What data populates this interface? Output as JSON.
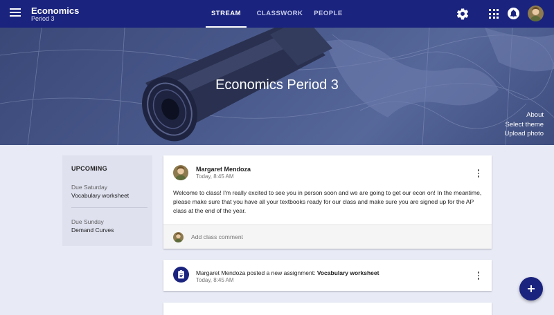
{
  "header": {
    "class_name": "Economics",
    "section": "Period 3",
    "tabs": [
      {
        "label": "STREAM",
        "active": true
      },
      {
        "label": "CLASSWORK",
        "active": false
      },
      {
        "label": "PEOPLE",
        "active": false
      }
    ],
    "icons": [
      "menu-icon",
      "gear-icon",
      "apps-grid-icon",
      "notification-icon",
      "avatar"
    ],
    "color": "#1a237e"
  },
  "banner": {
    "title": "Economics Period 3",
    "links": [
      "About",
      "Select theme",
      "Upload photo"
    ]
  },
  "upcoming": {
    "title": "UPCOMING",
    "items": [
      {
        "due": "Due Saturday",
        "name": "Vocabulary worksheet"
      },
      {
        "due": "Due Sunday",
        "name": "Demand Curves"
      }
    ]
  },
  "post": {
    "author": "Margaret Mendoza",
    "time": "Today, 8:45 AM",
    "body": "Welcome to class! I'm really excited to see you in person soon and we are going to get our econ on! In the meantime, please make sure that you have all your textbooks ready for our class and make sure you are signed up for the AP class at the end of the year.",
    "comment_placeholder": "Add class comment"
  },
  "assignment": {
    "text_prefix": "Margaret Mendoza posted a new assignment: ",
    "title": "Vocabulary worksheet",
    "time": "Today, 8:45 AM",
    "icon": "assignment-icon"
  },
  "fab": {
    "icon": "plus-icon",
    "color": "#1a237e"
  }
}
